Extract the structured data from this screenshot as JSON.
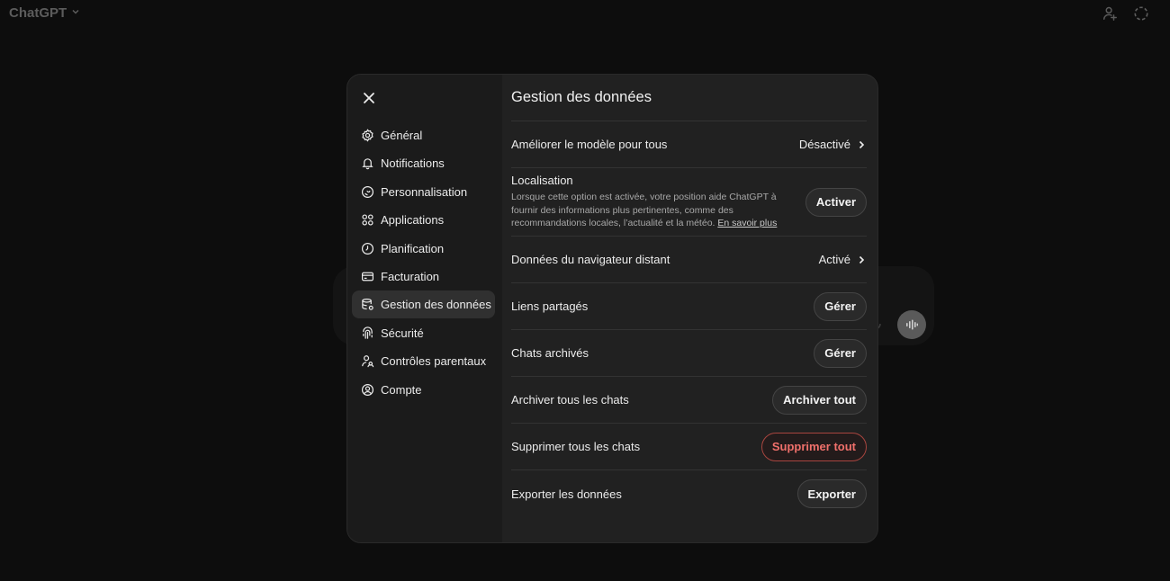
{
  "app": {
    "brand": "ChatGPT",
    "icons": {
      "brand_chevron": "chevron-down-icon",
      "share_user": "person-add-icon",
      "temporary_chat": "dashed-circle-icon"
    }
  },
  "modal": {
    "title": "Gestion des données",
    "close_icon": "close-icon",
    "sidebar": {
      "active": "Gestion des données",
      "items": [
        {
          "label": "Général",
          "icon": "gear-icon"
        },
        {
          "label": "Notifications",
          "icon": "bell-icon"
        },
        {
          "label": "Personnalisation",
          "icon": "personalization-icon"
        },
        {
          "label": "Applications",
          "icon": "grid-icon"
        },
        {
          "label": "Planification",
          "icon": "clock-icon"
        },
        {
          "label": "Facturation",
          "icon": "card-icon"
        },
        {
          "label": "Gestion des données",
          "icon": "database-icon"
        },
        {
          "label": "Sécurité",
          "icon": "fingerprint-icon"
        },
        {
          "label": "Contrôles parentaux",
          "icon": "parent-icon"
        },
        {
          "label": "Compte",
          "icon": "user-circle-icon"
        }
      ]
    },
    "rows": {
      "improve_model": {
        "label": "Améliorer le modèle pour tous",
        "value": "Désactivé"
      },
      "location": {
        "label": "Localisation",
        "description": "Lorsque cette option est activée, votre position aide ChatGPT à fournir des informations plus pertinentes, comme des recommandations locales, l’actualité et la météo.",
        "link": "En savoir plus",
        "button": "Activer"
      },
      "remote_browser": {
        "label": "Données du navigateur distant",
        "value": "Activé"
      },
      "shared_links": {
        "label": "Liens partagés",
        "button": "Gérer"
      },
      "archived_chats": {
        "label": "Chats archivés",
        "button": "Gérer"
      },
      "archive_all": {
        "label": "Archiver tous les chats",
        "button": "Archiver tout"
      },
      "delete_all": {
        "label": "Supprimer tous les chats",
        "button": "Supprimer tout"
      },
      "export": {
        "label": "Exporter les données",
        "button": "Exporter"
      }
    }
  },
  "colors": {
    "background": "#0d0d0d",
    "modal": "#212121",
    "danger": "#f0706b",
    "active_item": "#303030"
  }
}
